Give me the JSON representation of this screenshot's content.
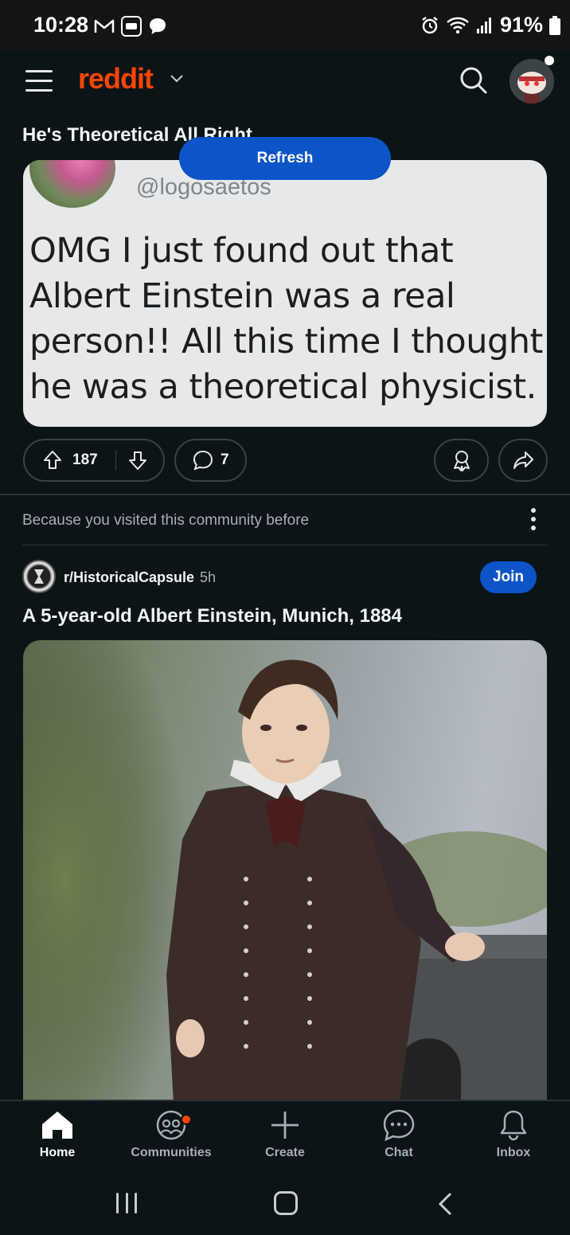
{
  "status_bar": {
    "time": "10:28",
    "battery": "91%"
  },
  "header": {
    "logo": "reddit"
  },
  "post1": {
    "title": "He's Theoretical All Right",
    "tweet_handle": "@logosaetos",
    "tweet_text": "OMG I just found out that Albert Einstein was a real person!! All this time I thought he was a theoretical physicist.",
    "votes": "187",
    "comments": "7"
  },
  "refresh_label": "Refresh",
  "feed_reason": "Because you visited this community before",
  "post2": {
    "subreddit": "r/HistoricalCapsule",
    "age": "5h",
    "join_label": "Join",
    "title": "A 5-year-old Albert Einstein, Munich, 1884"
  },
  "bottom_nav": {
    "items": [
      {
        "label": "Home",
        "icon": "home-icon",
        "active": true
      },
      {
        "label": "Communities",
        "icon": "communities-icon",
        "active": false
      },
      {
        "label": "Create",
        "icon": "plus-icon",
        "active": false
      },
      {
        "label": "Chat",
        "icon": "chat-icon",
        "active": false
      },
      {
        "label": "Inbox",
        "icon": "bell-icon",
        "active": false
      }
    ]
  },
  "colors": {
    "accent": "#ff4500",
    "primary_button": "#0d54c9",
    "background": "#0b1416"
  }
}
